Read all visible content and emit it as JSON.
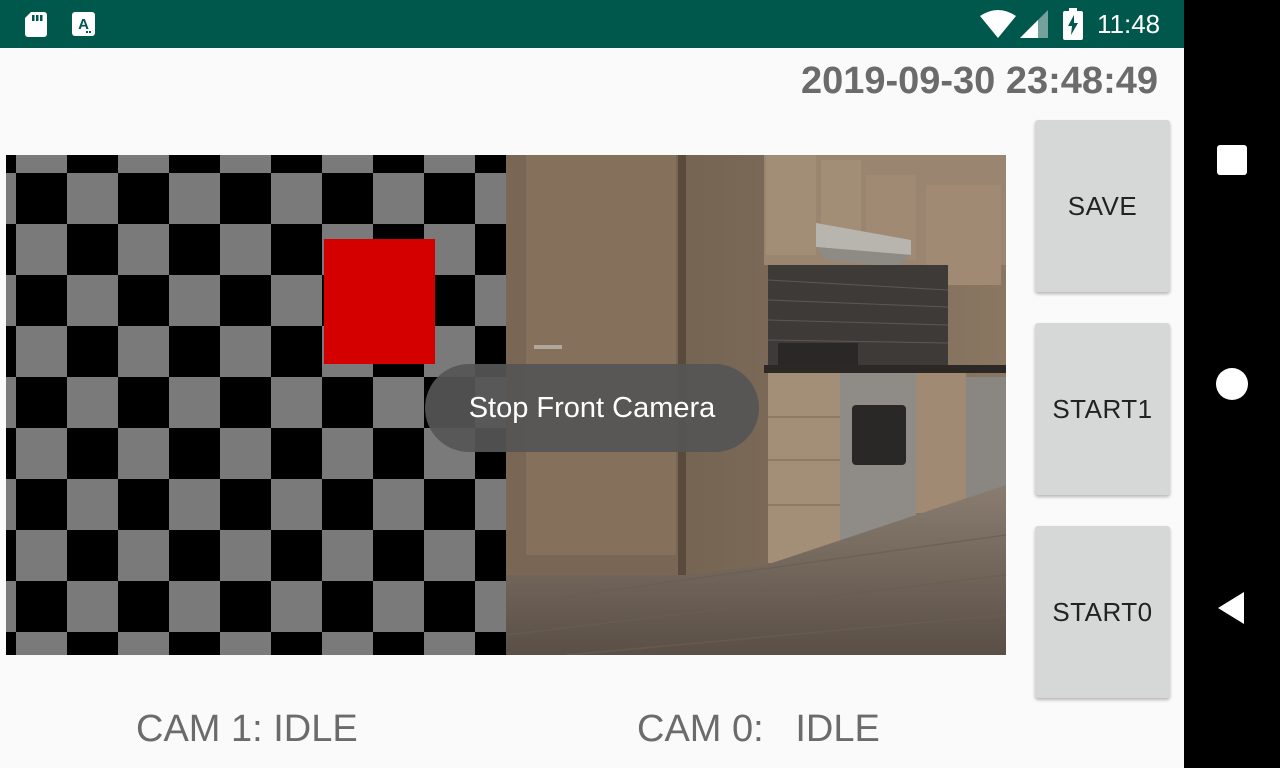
{
  "status_bar": {
    "time": "11:48",
    "icons": [
      "sd-card-icon",
      "a-badge-icon",
      "wifi-icon",
      "cellular-signal-icon",
      "battery-charging-icon"
    ],
    "background_color": "#00574b"
  },
  "timestamp": "2019-09-30 23:48:49",
  "toast": {
    "message": "Stop Front Camera"
  },
  "buttons": {
    "save_label": "SAVE",
    "start1_label": "START1",
    "start0_label": "START0"
  },
  "cam_status": {
    "cam1": "CAM 1: IDLE",
    "cam0": "CAM 0:   IDLE"
  },
  "cam_views": {
    "cam1": "checkerboard test pattern",
    "cam0": "kitchen camera feed"
  },
  "nav_bar": {
    "icons": [
      "recents-square-icon",
      "home-circle-icon",
      "back-triangle-icon"
    ]
  },
  "colors": {
    "accent_red": "#d40000",
    "button_gray": "#d6d7d7",
    "text_gray": "#6b6b6b"
  }
}
